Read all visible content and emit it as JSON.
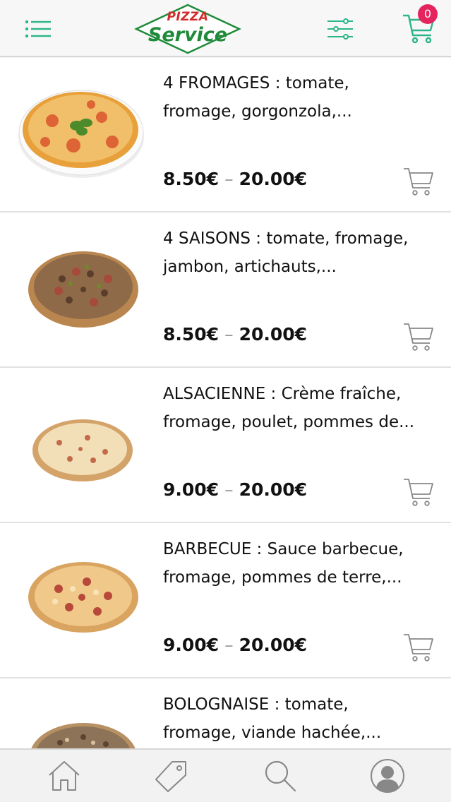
{
  "header": {
    "logo_top": "PIZZA",
    "logo_bottom": "Service",
    "cart_count": "0",
    "accent_color": "#2bb58a",
    "badge_color": "#e5245e",
    "icons": [
      "menu-icon",
      "filter-icon",
      "cart-icon"
    ]
  },
  "products": [
    {
      "description": "4 FROMAGES : tomate, fromage, gorgonzola,...",
      "price_min": "8.50€",
      "price_max": "20.00€",
      "image": "pizza-4-fromages-image"
    },
    {
      "description": "4 SAISONS : tomate, fromage, jambon, artichauts,...",
      "price_min": "8.50€",
      "price_max": "20.00€",
      "image": "pizza-4-saisons-image"
    },
    {
      "description": "ALSACIENNE : Crème fraîche, fromage, poulet, pommes de...",
      "price_min": "9.00€",
      "price_max": "20.00€",
      "image": "pizza-alsacienne-image"
    },
    {
      "description": "BARBECUE : Sauce barbecue, fromage, pommes de terre,...",
      "price_min": "9.00€",
      "price_max": "20.00€",
      "image": "pizza-barbecue-image"
    },
    {
      "description": "BOLOGNAISE : tomate, fromage, viande hachée,...",
      "price_min": "",
      "price_max": "",
      "image": "pizza-bolognaise-image"
    }
  ],
  "price_separator": "–",
  "bottom_nav": {
    "items": [
      "home-icon",
      "tag-icon",
      "search-icon",
      "account-icon"
    ]
  }
}
